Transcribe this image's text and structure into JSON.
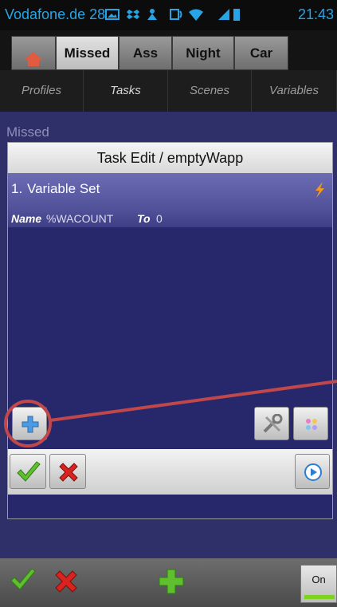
{
  "status_bar": {
    "carrier": "Vodafone.de 28",
    "time": "21:43"
  },
  "tabs": [
    {
      "label": ""
    },
    {
      "label": "Missed"
    },
    {
      "label": "Ass"
    },
    {
      "label": "Night"
    },
    {
      "label": "Car"
    }
  ],
  "subtabs": [
    {
      "label": "Profiles"
    },
    {
      "label": "Tasks"
    },
    {
      "label": "Scenes"
    },
    {
      "label": "Variables"
    }
  ],
  "background_label": "Missed",
  "dialog": {
    "title": "Task Edit / emptyWapp",
    "actions": [
      {
        "number": "1.",
        "name": "Variable Set",
        "arg_label_name": "Name",
        "arg_value_name": "%WACOUNT",
        "arg_label_to": "To",
        "arg_value_to": "0"
      }
    ]
  },
  "bottom_bar": {
    "on_label": "On"
  },
  "colors": {
    "accent": "#27a4e5",
    "dialog_bg": "#27276b",
    "action_bg": "#5b5ba4",
    "annotation": "#c0474a"
  }
}
